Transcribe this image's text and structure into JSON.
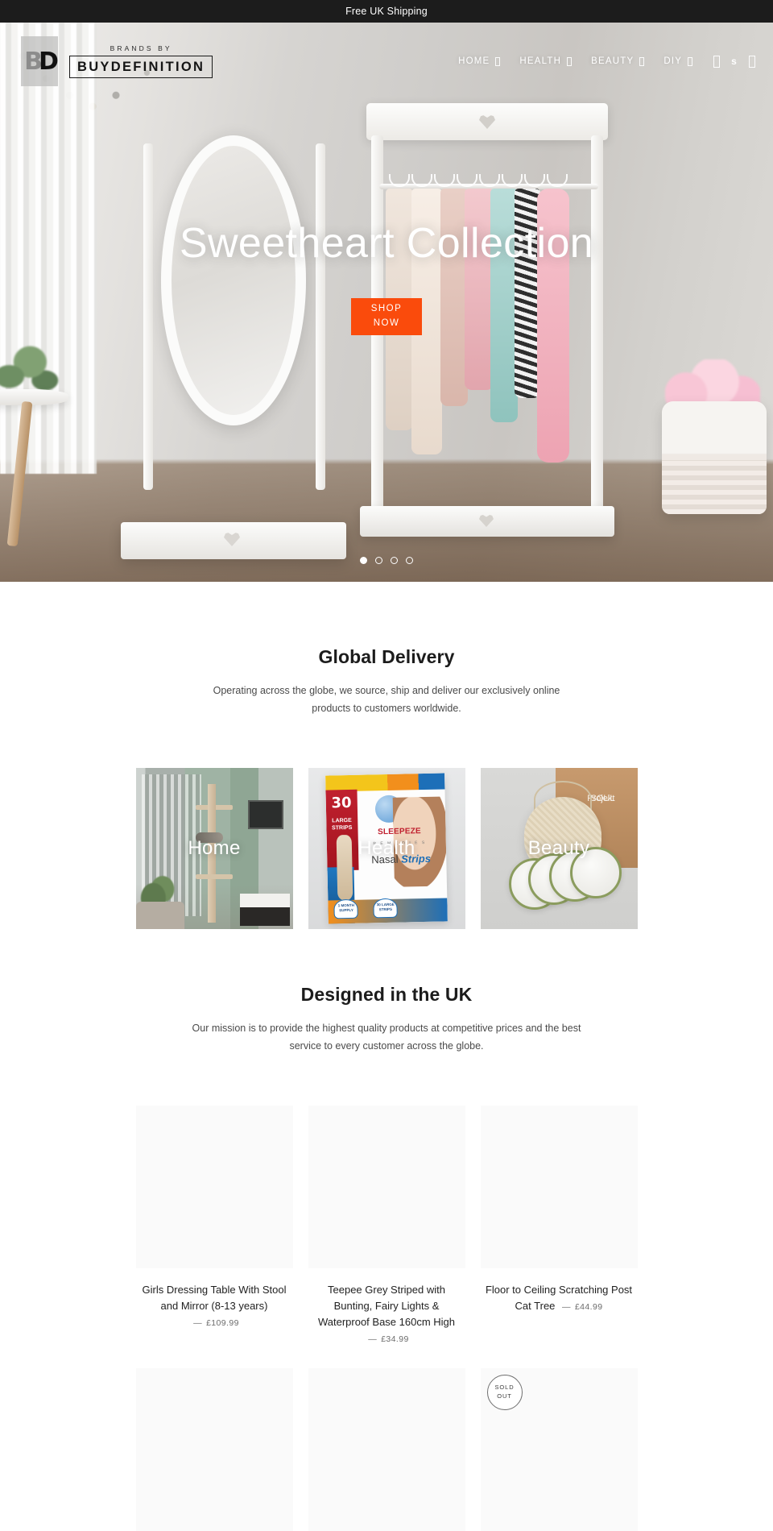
{
  "announcement": {
    "text": "Free UK Shipping"
  },
  "header": {
    "logo": {
      "mark_left": "B",
      "mark_right": "D",
      "sub": "BRANDS BY",
      "name": "BUYDEFINITION"
    },
    "nav": [
      {
        "label": "HOME",
        "icon": "chevron-down-icon"
      },
      {
        "label": "HEALTH",
        "icon": "chevron-down-icon"
      },
      {
        "label": "BEAUTY",
        "icon": "chevron-down-icon"
      },
      {
        "label": "DIY",
        "icon": "chevron-down-icon"
      }
    ],
    "icons": {
      "search": "search-icon",
      "account": "s",
      "cart": "cart-icon"
    }
  },
  "hero": {
    "title": "Sweetheart Collection",
    "cta": "SHOP\nNOW",
    "cta_line1": "SHOP",
    "cta_line2": "NOW",
    "cta_color": "#fa4b0c",
    "slides": 4,
    "active_slide": 1,
    "prev_label": "previous-slide",
    "next_label": "next-slide"
  },
  "global_delivery": {
    "title": "Global Delivery",
    "body": "Operating across the globe, we source, ship and deliver our exclusively online products to customers worldwide."
  },
  "categories": [
    {
      "label": "Home"
    },
    {
      "label": "Health"
    },
    {
      "label": "Beauty"
    }
  ],
  "health_tile_art": {
    "qty": "30",
    "large_strips": "LARGE STRIPS",
    "brand": "SLEEPEZE",
    "remedies": "R E M E D I E S",
    "nasal": "Nasal ",
    "strips": "Strips",
    "badge1": "1 MONTH SUPPLY",
    "badge2": "30 LARGE STRIPS"
  },
  "beauty_tile_art": {
    "kraft_line1": "SOUL",
    "kraft_line2": "Projekt"
  },
  "designed_uk": {
    "title": "Designed in the UK",
    "body": "Our mission is to provide the highest quality products at competitive prices and the best service to every customer across the globe."
  },
  "products_row1": [
    {
      "title": "Girls Dressing Table With Stool and Mirror (8-13 years)",
      "dash": "—",
      "price": "£109.99",
      "sold_out": false
    },
    {
      "title": "Teepee Grey Striped with Bunting, Fairy Lights & Waterproof Base 160cm High",
      "dash": "—",
      "price": "£34.99",
      "sold_out": false
    },
    {
      "title": "Floor to Ceiling Scratching Post Cat Tree",
      "dash": "—",
      "price": "£44.99",
      "sold_out": false
    }
  ],
  "products_row2": [
    {
      "title": "",
      "dash": "",
      "price": "",
      "sold_out": false
    },
    {
      "title": "",
      "dash": "",
      "price": "",
      "sold_out": false
    },
    {
      "title": "",
      "dash": "",
      "price": "",
      "sold_out": true
    }
  ],
  "sold_out_badge": {
    "line1": "SOLD",
    "line2": "OUT"
  }
}
